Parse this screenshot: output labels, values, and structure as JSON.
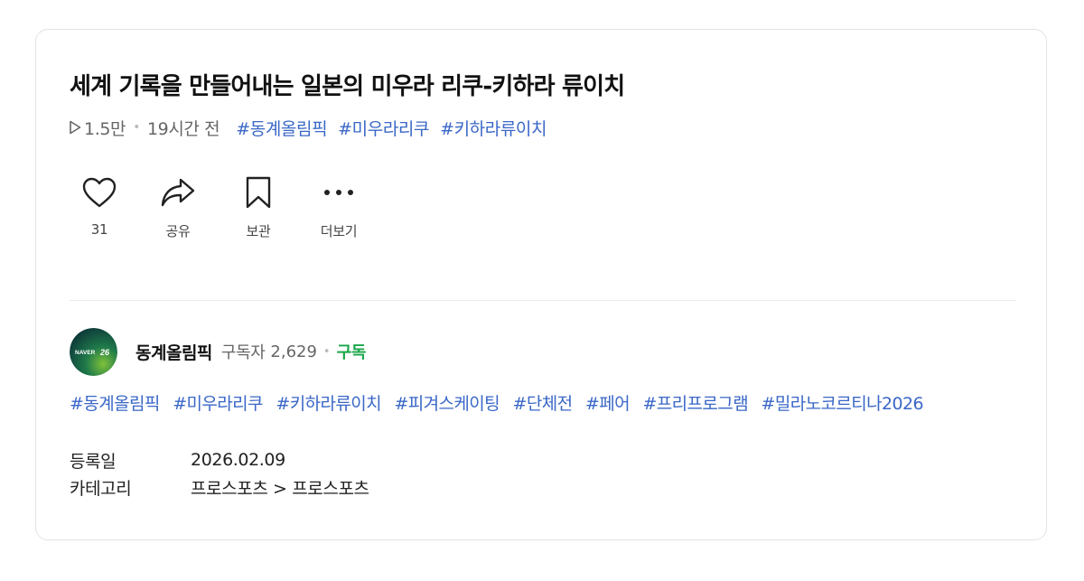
{
  "video": {
    "title": "세계 기록을 만들어내는 일본의 미우라 리쿠-키하라 류이치",
    "views": "1.5만",
    "time_ago": "19시간 전",
    "title_tags": [
      "#동계올림픽",
      "#미우라리쿠",
      "#키하라류이치"
    ]
  },
  "actions": {
    "like_count": "31",
    "share_label": "공유",
    "save_label": "보관",
    "more_label": "더보기"
  },
  "channel": {
    "name": "동계올림픽",
    "subscribers_label": "구독자",
    "subscribers_count": "2,629",
    "subscribe_label": "구독",
    "avatar_text": "NAVER"
  },
  "hashtags": [
    "#동계올림픽",
    "#미우라리쿠",
    "#키하라류이치",
    "#피겨스케이팅",
    "#단체전",
    "#페어",
    "#프리프로그램",
    "#밀라노코르티나2026"
  ],
  "info": {
    "date_label": "등록일",
    "date_value": "2026.02.09",
    "category_label": "카테고리",
    "category_value": "프로스포츠 > 프로스포츠"
  },
  "colors": {
    "tag": "#3a67c7",
    "subscribe": "#1aa64a",
    "avatar_bg": "#0e4a3a"
  },
  "icons": [
    "play-icon",
    "heart-icon",
    "share-icon",
    "bookmark-icon",
    "more-icon"
  ]
}
